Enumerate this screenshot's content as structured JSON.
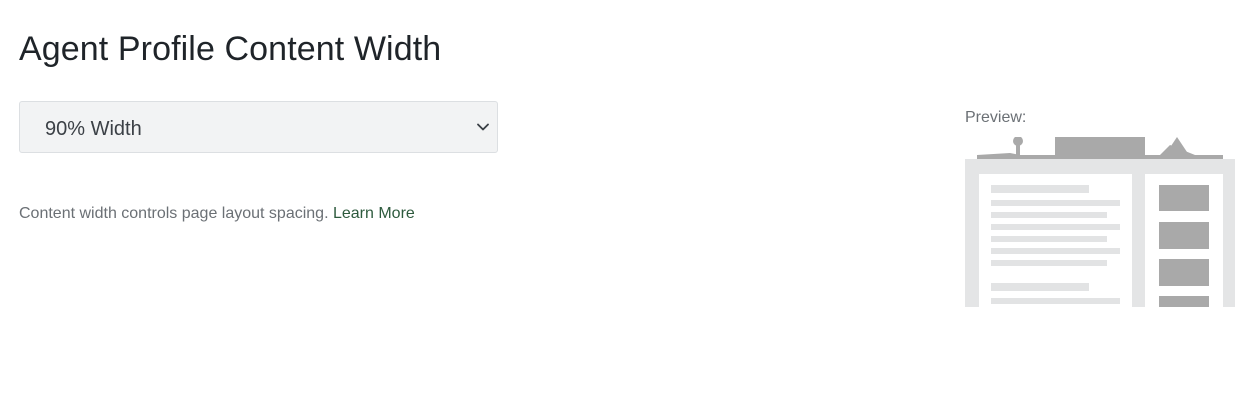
{
  "page": {
    "title": "Agent Profile Content Width"
  },
  "width_select": {
    "selected": "90% Width",
    "icon": "chevron-down-icon"
  },
  "helper": {
    "text": "Content width controls page layout spacing.",
    "link_label": "Learn More",
    "link_color": "#2d5a3d"
  },
  "preview": {
    "label": "Preview:",
    "content_width": "90%"
  }
}
